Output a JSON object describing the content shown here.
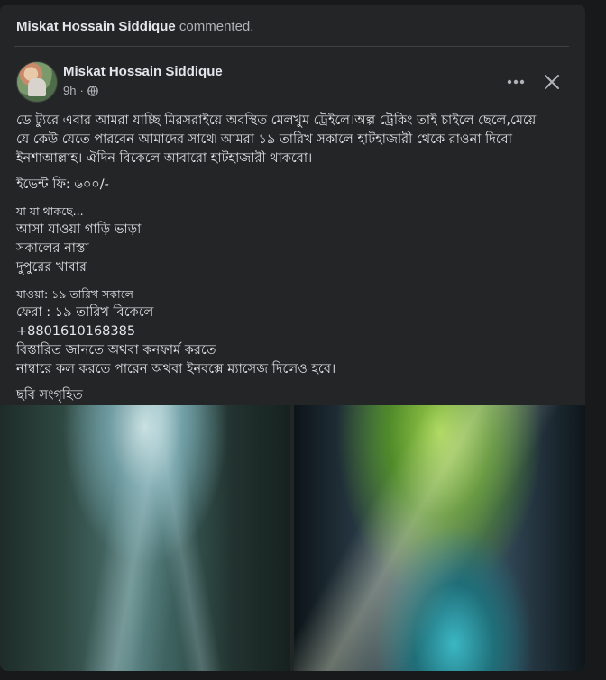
{
  "activity": {
    "actor": "Miskat Hossain Siddique",
    "verb": "commented."
  },
  "post": {
    "author": "Miskat Hossain Siddique",
    "time": "9h",
    "separator": "·",
    "privacy_icon": "globe-icon",
    "lines": [
      "ডে ট্যুরে এবার আমরা যাচ্ছি মিরসরাইয়ে  অবস্থিত  মেলখুম ট্রেইলে।অল্প ট্রেকিং তাই চাইলে ছেলে,মেয়ে",
      "যে কেউ যেতে পারবেন আমাদের সাথে৷ আমরা ১৯ তারিখ সকালে হাটহাজারী থেকে রাওনা দিবো",
      "ইনশাআল্লাহ। ঐদিন বিকেলে আবারো হাটহাজারী থাকবো।",
      "ইভেন্ট ফি: ৬০০/-",
      "যা যা থাকছে...",
      "আসা যাওয়া গাড়ি ভাড়া",
      "সকালের নাস্তা",
      "দুপুরের খাবার",
      "যাওয়া: ১৯ তারিখ সকালে",
      "ফেরা : ১৯ তারিখ বিকেলে",
      "+8801610168385",
      "বিস্তারিত জানতে অথবা কনফার্ম করতে",
      " নাম্বারে কল করতে পারেন অথবা ইনবক্সে ম্যাসেজ দিলেও হবে।",
      "ছবি সংগৃহিত"
    ]
  },
  "colors": {
    "page_bg": "#18191a",
    "card_bg": "#242526",
    "primary_text": "#e4e6eb",
    "secondary_text": "#b0b3b8"
  }
}
